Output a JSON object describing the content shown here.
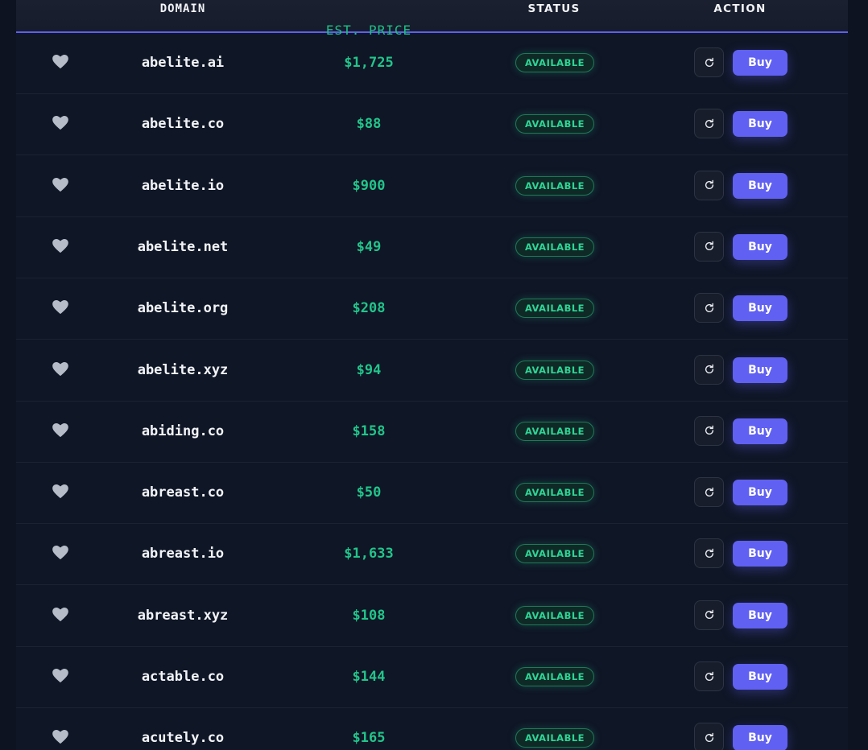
{
  "header": {
    "domain_label": "DOMAIN",
    "price_label": "EST. PRICE",
    "status_label": "STATUS",
    "action_label": "ACTION"
  },
  "buttons": {
    "buy_label": "Buy"
  },
  "icons": {
    "favorite": "heart-icon",
    "refresh": "refresh-icon"
  },
  "colors": {
    "accent": "#5b5ff0",
    "buy": "#6060f2",
    "price": "#22c58a",
    "status": "#2fd596"
  },
  "rows": [
    {
      "domain": "abelite.ai",
      "price": "$1,725",
      "status": "AVAILABLE"
    },
    {
      "domain": "abelite.co",
      "price": "$88",
      "status": "AVAILABLE"
    },
    {
      "domain": "abelite.io",
      "price": "$900",
      "status": "AVAILABLE"
    },
    {
      "domain": "abelite.net",
      "price": "$49",
      "status": "AVAILABLE"
    },
    {
      "domain": "abelite.org",
      "price": "$208",
      "status": "AVAILABLE"
    },
    {
      "domain": "abelite.xyz",
      "price": "$94",
      "status": "AVAILABLE"
    },
    {
      "domain": "abiding.co",
      "price": "$158",
      "status": "AVAILABLE"
    },
    {
      "domain": "abreast.co",
      "price": "$50",
      "status": "AVAILABLE"
    },
    {
      "domain": "abreast.io",
      "price": "$1,633",
      "status": "AVAILABLE"
    },
    {
      "domain": "abreast.xyz",
      "price": "$108",
      "status": "AVAILABLE"
    },
    {
      "domain": "actable.co",
      "price": "$144",
      "status": "AVAILABLE"
    },
    {
      "domain": "acutely.co",
      "price": "$165",
      "status": "AVAILABLE"
    }
  ]
}
